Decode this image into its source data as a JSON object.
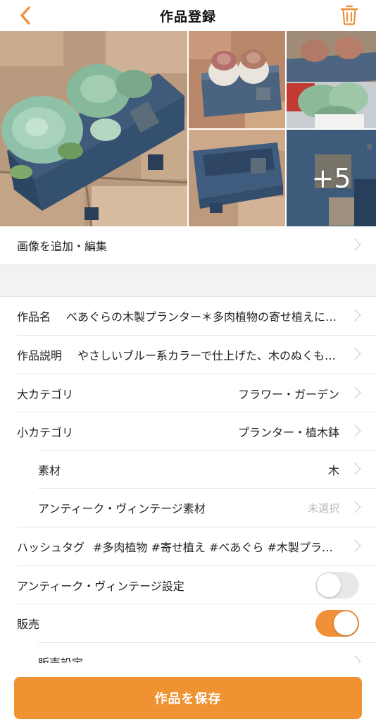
{
  "header": {
    "title": "作品登録",
    "back_icon": "chevron-left-icon",
    "delete_icon": "trash-icon",
    "accent": "#F0913A"
  },
  "photos": {
    "more_count_label": "+5"
  },
  "add_images": {
    "label": "画像を追加・編集"
  },
  "form": {
    "title": {
      "label": "作品名",
      "value": "べあぐらの木製プランター＊多肉植物の寄せ植えに最適"
    },
    "description": {
      "label": "作品説明",
      "value": "やさしいブルー系カラーで仕上げた、木のぬくもりあふれるプランターです"
    },
    "major_category": {
      "label": "大カテゴリ",
      "value": "フラワー・ガーデン"
    },
    "minor_category": {
      "label": "小カテゴリ",
      "value": "プランター・植木鉢"
    },
    "material": {
      "label": "素材",
      "value": "木"
    },
    "antique_material": {
      "label": "アンティーク・ヴィンテージ素材",
      "value": "未選択"
    },
    "hashtags": {
      "label": "ハッシュタグ",
      "value": "#多肉植物 #寄せ植え #べあぐら #木製プランター"
    },
    "antique_setting": {
      "label": "アンティーク・ヴィンテージ設定",
      "on": false
    },
    "sale": {
      "label": "販売",
      "on": true
    },
    "sale_settings": {
      "label": "販売設定"
    }
  },
  "save_button": {
    "label": "作品を保存"
  }
}
